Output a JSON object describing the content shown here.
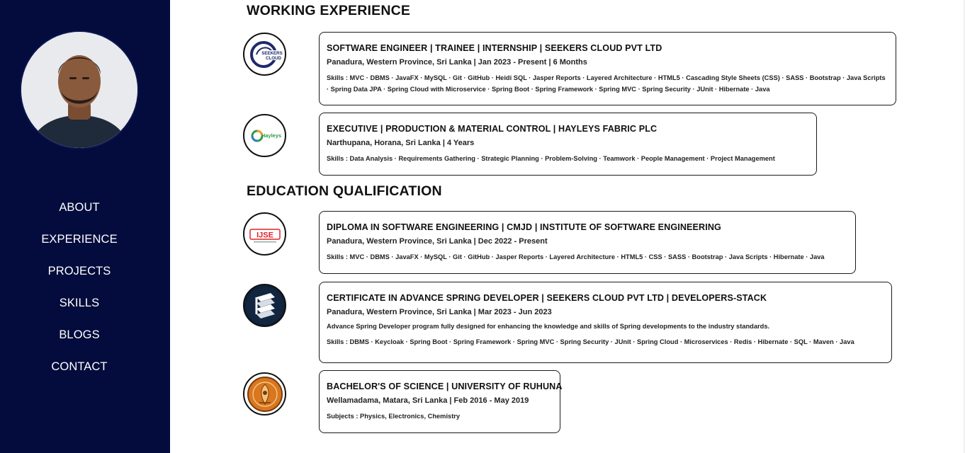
{
  "nav": {
    "items": [
      "ABOUT",
      "EXPERIENCE",
      "PROJECTS",
      "SKILLS",
      "BLOGS",
      "CONTACT"
    ]
  },
  "sections": {
    "experience_title": "WORKING EXPERIENCE",
    "education_title": "EDUCATION QUALIFICATION"
  },
  "experience": [
    {
      "logo_icon": "seekers-cloud-logo-icon",
      "logo_text": "SEEKERS CLOUD",
      "title": "SOFTWARE ENGINEER | TRAINEE | INTERNSHIP | SEEKERS CLOUD PVT LTD",
      "meta": "Panadura, Western Province, Sri Lanka | Jan 2023 - Present | 6 Months",
      "skills": "Skills : MVC · DBMS · JavaFX · MySQL · Git · GitHub · Heidi SQL · Jasper Reports · Layered Architecture · HTML5 · Cascading Style Sheets (CSS) · SASS · Bootstrap · Java Scripts · Spring Data JPA · Spring Cloud with Microservice · Spring Boot · Spring Framework · Spring MVC · Spring Security · JUnit · Hibernate · Java"
    },
    {
      "logo_icon": "hayleys-logo-icon",
      "logo_text": "Hayleys",
      "title": "EXECUTIVE | PRODUCTION & MATERIAL CONTROL | HAYLEYS FABRIC PLC",
      "meta": "Narthupana, Horana, Sri Lanka | 4 Years",
      "skills": "Skills : Data Analysis · Requirements Gathering · Strategic Planning · Problem-Solving · Teamwork · People Management · Project Management"
    }
  ],
  "education": [
    {
      "logo_icon": "ijse-logo-icon",
      "logo_text": "IJSE",
      "title": "DIPLOMA IN SOFTWARE ENGINEERING | CMJD | INSTITUTE OF SOFTWARE ENGINEERING",
      "meta": "Panadura, Western Province, Sri Lanka | Dec 2022 - Present",
      "skills": "Skills : MVC · DBMS · JavaFX · MySQL · Git · GitHub · Jasper Reports · Layered Architecture · HTML5 · CSS · SASS · Bootstrap · Java Scripts · Hibernate · Java"
    },
    {
      "logo_icon": "developers-stack-logo-icon",
      "title": "CERTIFICATE IN ADVANCE SPRING DEVELOPER | SEEKERS CLOUD PVT LTD | DEVELOPERS-STACK",
      "meta": "Panadura, Western Province, Sri Lanka | Mar 2023 - Jun 2023",
      "description": "Advance Spring Developer program fully designed for enhancing the knowledge and skills of Spring developments to the industry standards.",
      "skills": "Skills : DBMS · Keycloak · Spring Boot · Spring Framework · Spring MVC · Spring Security · JUnit · Spring Cloud · Microservices · Redis · Hibernate · SQL · Maven · Java"
    },
    {
      "logo_icon": "university-of-ruhuna-crest-icon",
      "title": "BACHELOR'S OF SCIENCE | UNIVERSITY OF RUHUNA",
      "meta": "Wellamadama, Matara, Sri Lanka | Feb 2016 - May 2019",
      "skills": "Subjects : Physics, Electronics, Chemistry"
    }
  ],
  "colors": {
    "sidebar_bg": "#030c3d",
    "nav_text": "#ffffff",
    "card_border": "#1a1a1a",
    "ijse_red": "#e0232a",
    "ruhuna_orange": "#d9771f"
  }
}
